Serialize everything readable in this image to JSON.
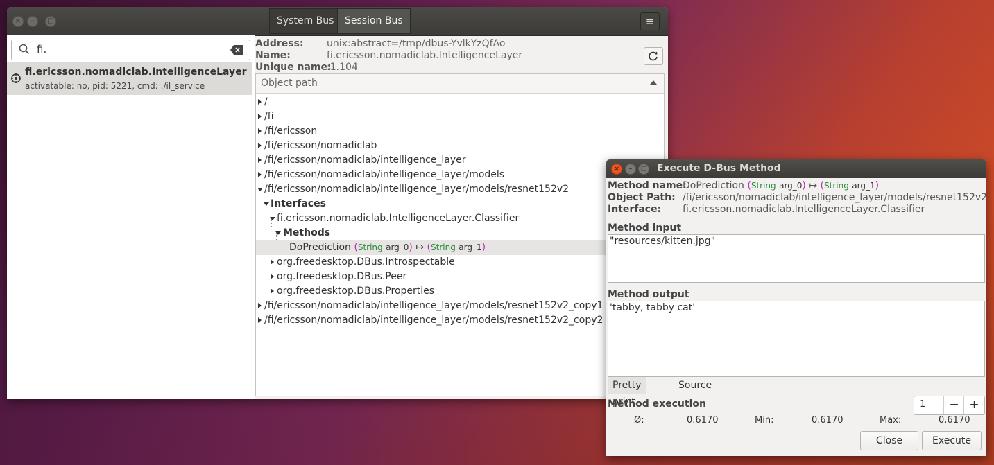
{
  "header": {
    "tabs": [
      "System Bus",
      "Session Bus"
    ],
    "active_tab": "Session Bus"
  },
  "search": {
    "value": "fi."
  },
  "bus_list": [
    {
      "name": "fi.ericsson.nomadiclab.IntelligenceLayer",
      "info": "activatable: no, pid: 5221, cmd: ./il_service"
    }
  ],
  "details": {
    "address_label": "Address:",
    "address": "unix:abstract=/tmp/dbus-YvlkYzQfAo",
    "name_label": "Name:",
    "name": "fi.ericsson.nomadiclab.IntelligenceLayer",
    "unique_label": "Unique name:",
    "unique": ":1.104"
  },
  "tree": {
    "column_header": "Object path",
    "rows": [
      {
        "text": "/"
      },
      {
        "text": "/fi"
      },
      {
        "text": "/fi/ericsson"
      },
      {
        "text": "/fi/ericsson/nomadiclab"
      },
      {
        "text": "/fi/ericsson/nomadiclab/intelligence_layer"
      },
      {
        "text": "/fi/ericsson/nomadiclab/intelligence_layer/models"
      },
      {
        "text": "/fi/ericsson/nomadiclab/intelligence_layer/models/resnet152v2"
      },
      {
        "text": "Interfaces"
      },
      {
        "text": "fi.ericsson.nomadiclab.IntelligenceLayer.Classifier"
      },
      {
        "text": "Methods"
      },
      {
        "text": "DoPrediction"
      },
      {
        "text": "org.freedesktop.DBus.Introspectable"
      },
      {
        "text": "org.freedesktop.DBus.Peer"
      },
      {
        "text": "org.freedesktop.DBus.Properties"
      },
      {
        "text": "/fi/ericsson/nomadiclab/intelligence_layer/models/resnet152v2_copy1"
      },
      {
        "text": "/fi/ericsson/nomadiclab/intelligence_layer/models/resnet152v2_copy2"
      }
    ],
    "signature": {
      "open": "(",
      "in_type": "String",
      "in_arg": "arg_0",
      "close": ")",
      "arrow": "↦",
      "out_type": "String",
      "out_arg": "arg_1"
    }
  },
  "dialog": {
    "title": "Execute D-Bus Method",
    "method_name_label": "Method name:",
    "method_name": "DoPrediction",
    "object_path_label": "Object Path:",
    "object_path": "/fi/ericsson/nomadiclab/intelligence_layer/models/resnet152v2",
    "interface_label": "Interface:",
    "interface": "fi.ericsson.nomadiclab.IntelligenceLayer.Classifier",
    "input_label": "Method input",
    "input_value": "\"resources/kitten.jpg\"",
    "output_label": "Method output",
    "output_value": "'tabby, tabby cat'",
    "tabs": [
      "Pretty print",
      "Source"
    ],
    "active_tab": "Source",
    "execution_label": "Method execution",
    "repeat_count": "1",
    "avg_label": "Ø:",
    "avg": "0.6170",
    "min_label": "Min:",
    "min": "0.6170",
    "max_label": "Max:",
    "max": "0.6170",
    "close_label": "Close",
    "execute_label": "Execute"
  },
  "colors": {
    "signature_paren": "#c12bb9",
    "signature_type": "#2c8c3a",
    "titlebar": "#3c3b37"
  }
}
